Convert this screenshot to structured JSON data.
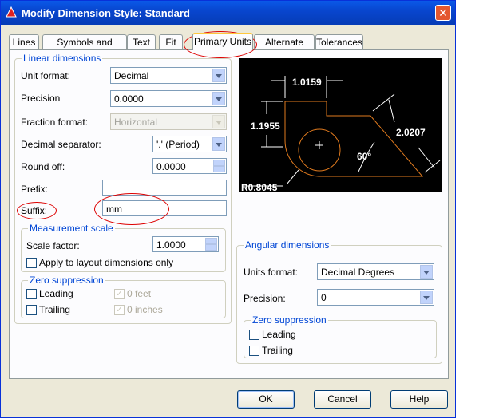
{
  "window": {
    "title": "Modify Dimension Style: Standard",
    "close_glyph": "✕"
  },
  "tabs": [
    "Lines",
    "Symbols and Arrows",
    "Text",
    "Fit",
    "Primary Units",
    "Alternate Units",
    "Tolerances"
  ],
  "active_tab": "Primary Units",
  "linear": {
    "title": "Linear dimensions",
    "unit_format": {
      "label": "Unit format:",
      "value": "Decimal"
    },
    "precision": {
      "label": "Precision",
      "value": "0.0000"
    },
    "fraction_format": {
      "label": "Fraction format:",
      "value": "Horizontal"
    },
    "decimal_separator": {
      "label": "Decimal separator:",
      "value": "'.' (Period)"
    },
    "round_off": {
      "label": "Round off:",
      "value": "0.0000"
    },
    "prefix": {
      "label": "Prefix:",
      "value": ""
    },
    "suffix": {
      "label": "Suffix:",
      "value": "mm"
    }
  },
  "measurement": {
    "title": "Measurement scale",
    "scale_factor": {
      "label": "Scale factor:",
      "value": "1.0000"
    },
    "apply_layout": "Apply to layout dimensions only"
  },
  "zero_linear": {
    "title": "Zero suppression",
    "leading": "Leading",
    "trailing": "Trailing",
    "feet": "0 feet",
    "inches": "0 inches"
  },
  "angular": {
    "title": "Angular dimensions",
    "units_format": {
      "label": "Units format:",
      "value": "Decimal Degrees"
    },
    "precision": {
      "label": "Precision:",
      "value": "0"
    }
  },
  "zero_angular": {
    "title": "Zero suppression",
    "leading": "Leading",
    "trailing": "Trailing"
  },
  "preview": {
    "dim_top": "1.0159",
    "dim_left": "1.1955",
    "dim_right": "2.0207",
    "angle": "60°",
    "radius": "R0.8045"
  },
  "buttons": {
    "ok": "OK",
    "cancel": "Cancel",
    "help": "Help"
  },
  "colors": {
    "titlebar": "#0846cf",
    "group_title": "#0046d5",
    "highlight": "#dd0000",
    "preview_bg": "#000000",
    "shape": "#e07a1e"
  }
}
